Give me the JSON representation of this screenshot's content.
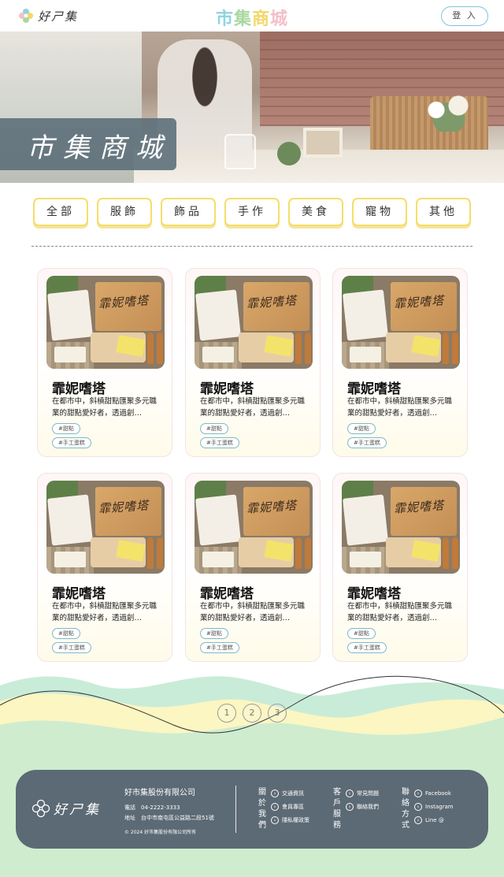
{
  "header": {
    "logo_text": "好ㄕ集",
    "title_chars": [
      "市",
      "集",
      "商",
      "城"
    ],
    "login_label": "登 入"
  },
  "hero": {
    "label": "市集商城"
  },
  "categories": [
    "全部",
    "服飾",
    "飾品",
    "手作",
    "美食",
    "寵物",
    "其他"
  ],
  "cards": [
    {
      "title": "霏妮嗜塔",
      "desc": "在都市中，斜槓甜點匯聚多元職業的甜點愛好者，透過創…",
      "tags": [
        "#甜點",
        "#手工蛋糕"
      ],
      "img_text": "霏妮嗜塔"
    },
    {
      "title": "霏妮嗜塔",
      "desc": "在都市中，斜槓甜點匯聚多元職業的甜點愛好者，透過創…",
      "tags": [
        "#甜點",
        "#手工蛋糕"
      ],
      "img_text": "霏妮嗜塔"
    },
    {
      "title": "霏妮嗜塔",
      "desc": "在都市中，斜槓甜點匯聚多元職業的甜點愛好者，透過創…",
      "tags": [
        "#甜點",
        "#手工蛋糕"
      ],
      "img_text": "霏妮嗜塔"
    },
    {
      "title": "霏妮嗜塔",
      "desc": "在都市中，斜槓甜點匯聚多元職業的甜點愛好者，透過創…",
      "tags": [
        "#甜點",
        "#手工蛋糕"
      ],
      "img_text": "霏妮嗜塔"
    },
    {
      "title": "霏妮嗜塔",
      "desc": "在都市中，斜槓甜點匯聚多元職業的甜點愛好者，透過創…",
      "tags": [
        "#甜點",
        "#手工蛋糕"
      ],
      "img_text": "霏妮嗜塔"
    },
    {
      "title": "霏妮嗜塔",
      "desc": "在都市中，斜槓甜點匯聚多元職業的甜點愛好者，透過創…",
      "tags": [
        "#甜點",
        "#手工蛋糕"
      ],
      "img_text": "霏妮嗜塔"
    }
  ],
  "pagination": [
    "1",
    "2",
    "3"
  ],
  "footer": {
    "logo_text": "好ㄕ集",
    "company": "好市集股份有限公司",
    "phone": "電話　04-2222-3333",
    "address": "地址　台中市南屯區公益路二段51號",
    "copyright": "© 2024 好市集股份有限公司所有",
    "about_head": "關於我們",
    "about_links": [
      "交通資訊",
      "會員專區",
      "隱私權政策"
    ],
    "service_head": "客戶服務",
    "service_links": [
      "常見問題",
      "聯絡我們"
    ],
    "contact_head": "聯絡方式",
    "contact_links": [
      "Facebook",
      "Instagram",
      "Line @"
    ]
  },
  "colors": {
    "accent_blue": "#7fc4d6",
    "category_yellow": "#f5de6a",
    "footer_bg": "#5c6a75",
    "wave_green": "#cdeccf",
    "wave_yellow": "#fbf6c2"
  }
}
